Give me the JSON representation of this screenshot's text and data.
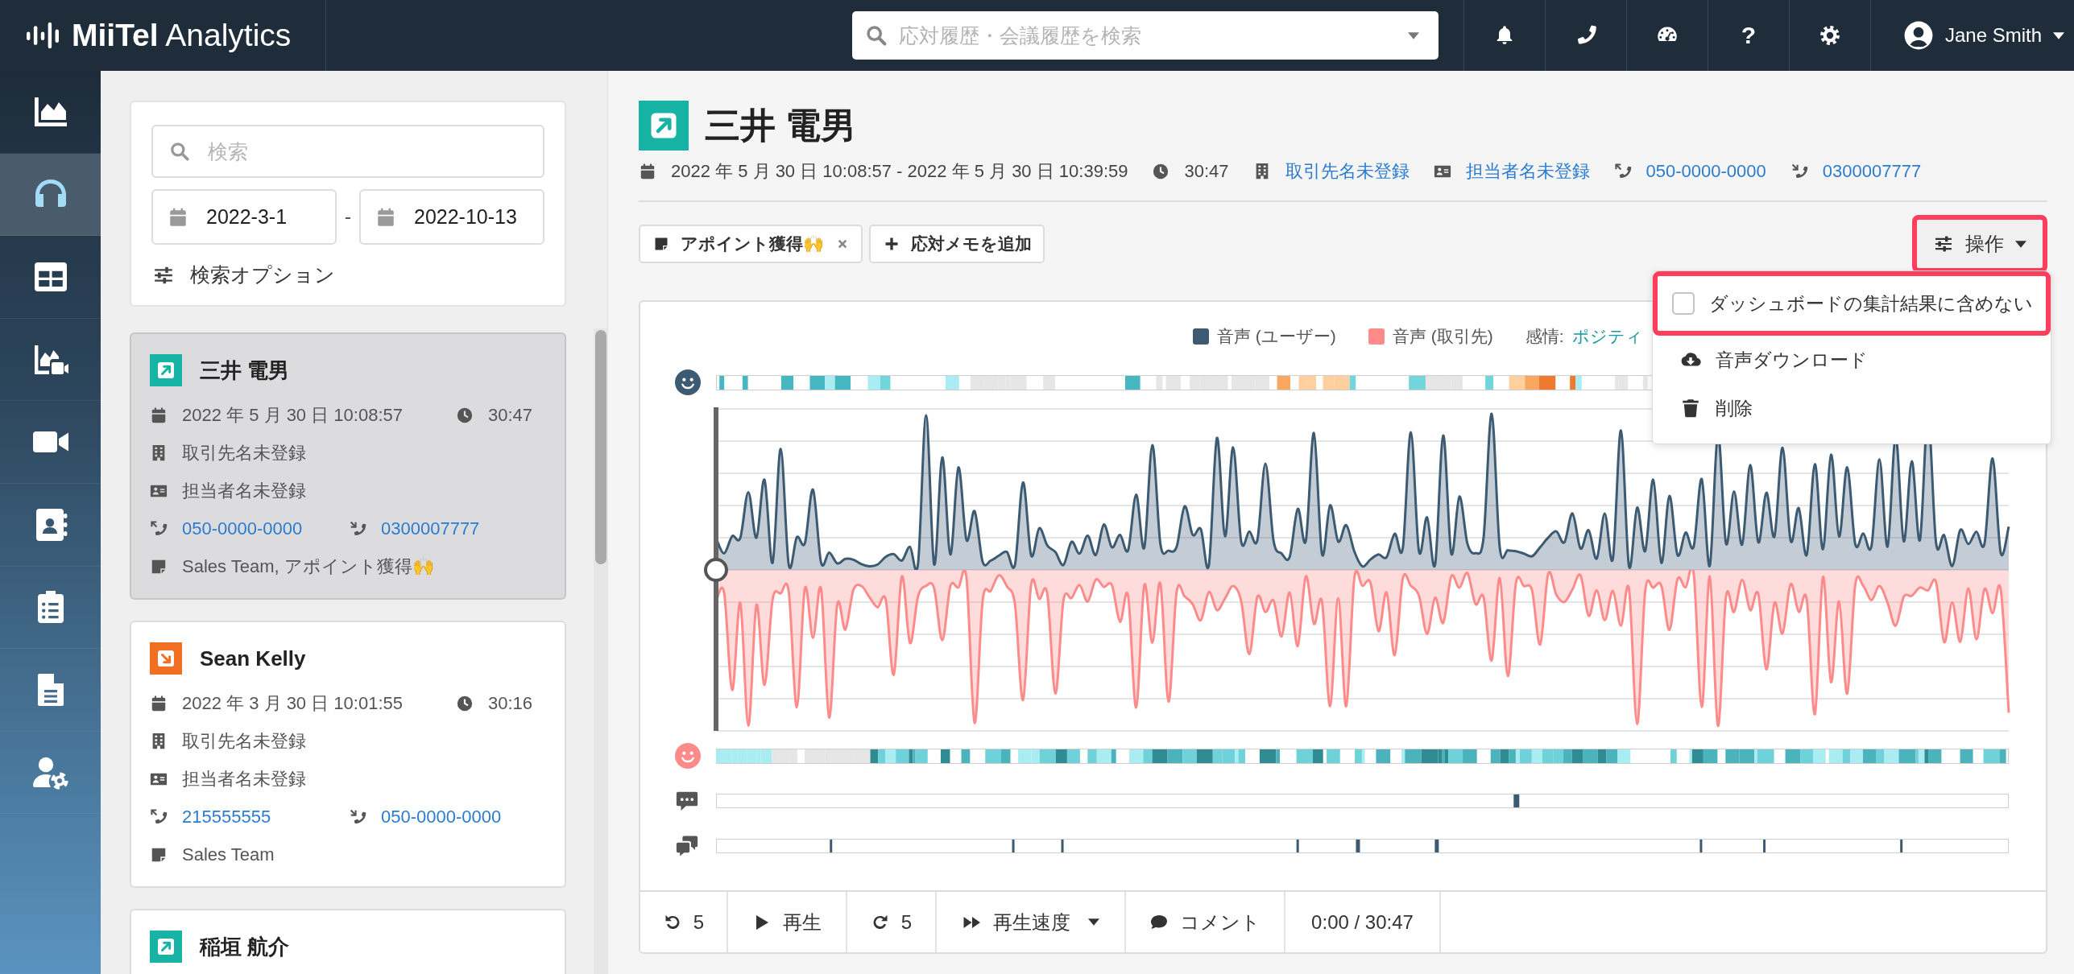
{
  "topbar": {
    "logo": "**MiiTel** Analytics",
    "search": {
      "placeholder": "応対履歴・会議履歴を検索"
    },
    "help": "?",
    "user": "Jane Smith"
  },
  "nav": {
    "items": [
      {
        "kind": "analytics",
        "selected": false
      },
      {
        "kind": "calls",
        "selected": true
      },
      {
        "kind": "dashboard",
        "selected": false
      },
      {
        "kind": "meeting_analytics",
        "selected": false
      },
      {
        "kind": "meetings",
        "selected": false
      },
      {
        "kind": "contacts",
        "selected": false
      },
      {
        "kind": "tasks",
        "selected": false
      },
      {
        "kind": "documents",
        "selected": false
      },
      {
        "kind": "user_settings",
        "selected": false
      }
    ]
  },
  "search_panel": {
    "search": {
      "placeholder": "検索"
    },
    "date_from": "2022-3-1",
    "separator": "-",
    "date_to": "2022-10-13",
    "options": "検索オプション"
  },
  "call_list": [
    {
      "kind": "outgoing",
      "name": "三井 電男",
      "selected": true,
      "datetime": "2022 年 5 月 30 日 10:08:57",
      "duration": "30:47",
      "company": "取引先名未登録",
      "contact": "担当者名未登録",
      "from_number": "050-0000-0000",
      "to_number": "0300007777",
      "tags": "Sales Team, アポイント獲得🙌"
    },
    {
      "kind": "incoming",
      "name": "Sean Kelly",
      "selected": false,
      "datetime": "2022 年 3 月 30 日 10:01:55",
      "duration": "30:16",
      "company": "取引先名未登録",
      "contact": "担当者名未登録",
      "from_number": "215555555",
      "to_number": "050-0000-0000",
      "tags": "Sales Team"
    },
    {
      "kind": "outgoing",
      "name": "稲垣 航介",
      "selected": false
    }
  ],
  "detail": {
    "kind": "outgoing",
    "name": "三井 電男",
    "period": "2022 年 5 月 30 日 10:08:57 - 2022 年 5 月 30 日 10:39:59",
    "duration": "30:47",
    "company": "取引先名未登録",
    "contact": "担当者名未登録",
    "from_number": "050-0000-0000",
    "to_number": "0300007777",
    "tags": [
      {
        "label": "アポイント獲得🙌",
        "removable": true
      }
    ],
    "add_memo": "応対メモを追加",
    "actions": {
      "label": "操作",
      "highlighted": true
    },
    "actions_menu": [
      {
        "kind": "checkbox",
        "label": "ダッシュボードの集計結果に含めない",
        "checked": false,
        "highlighted": true
      },
      {
        "kind": "download",
        "label": "音声ダウンロード",
        "highlighted": false
      },
      {
        "kind": "delete",
        "label": "削除",
        "highlighted": false
      }
    ]
  },
  "chart": {
    "legend": [
      {
        "label": "音声 (ユーザー)",
        "color": "#3d5a73"
      },
      {
        "label": "音声 (取引先)",
        "color": "#ff8a8a"
      }
    ],
    "sentiment_label": "感情:",
    "sentiment_value": "ポジティ"
  },
  "player": {
    "rewind": "5",
    "play": "再生",
    "forward": "5",
    "speed": "再生速度",
    "comment": "コメント",
    "time": "0:00 / 30:47"
  }
}
